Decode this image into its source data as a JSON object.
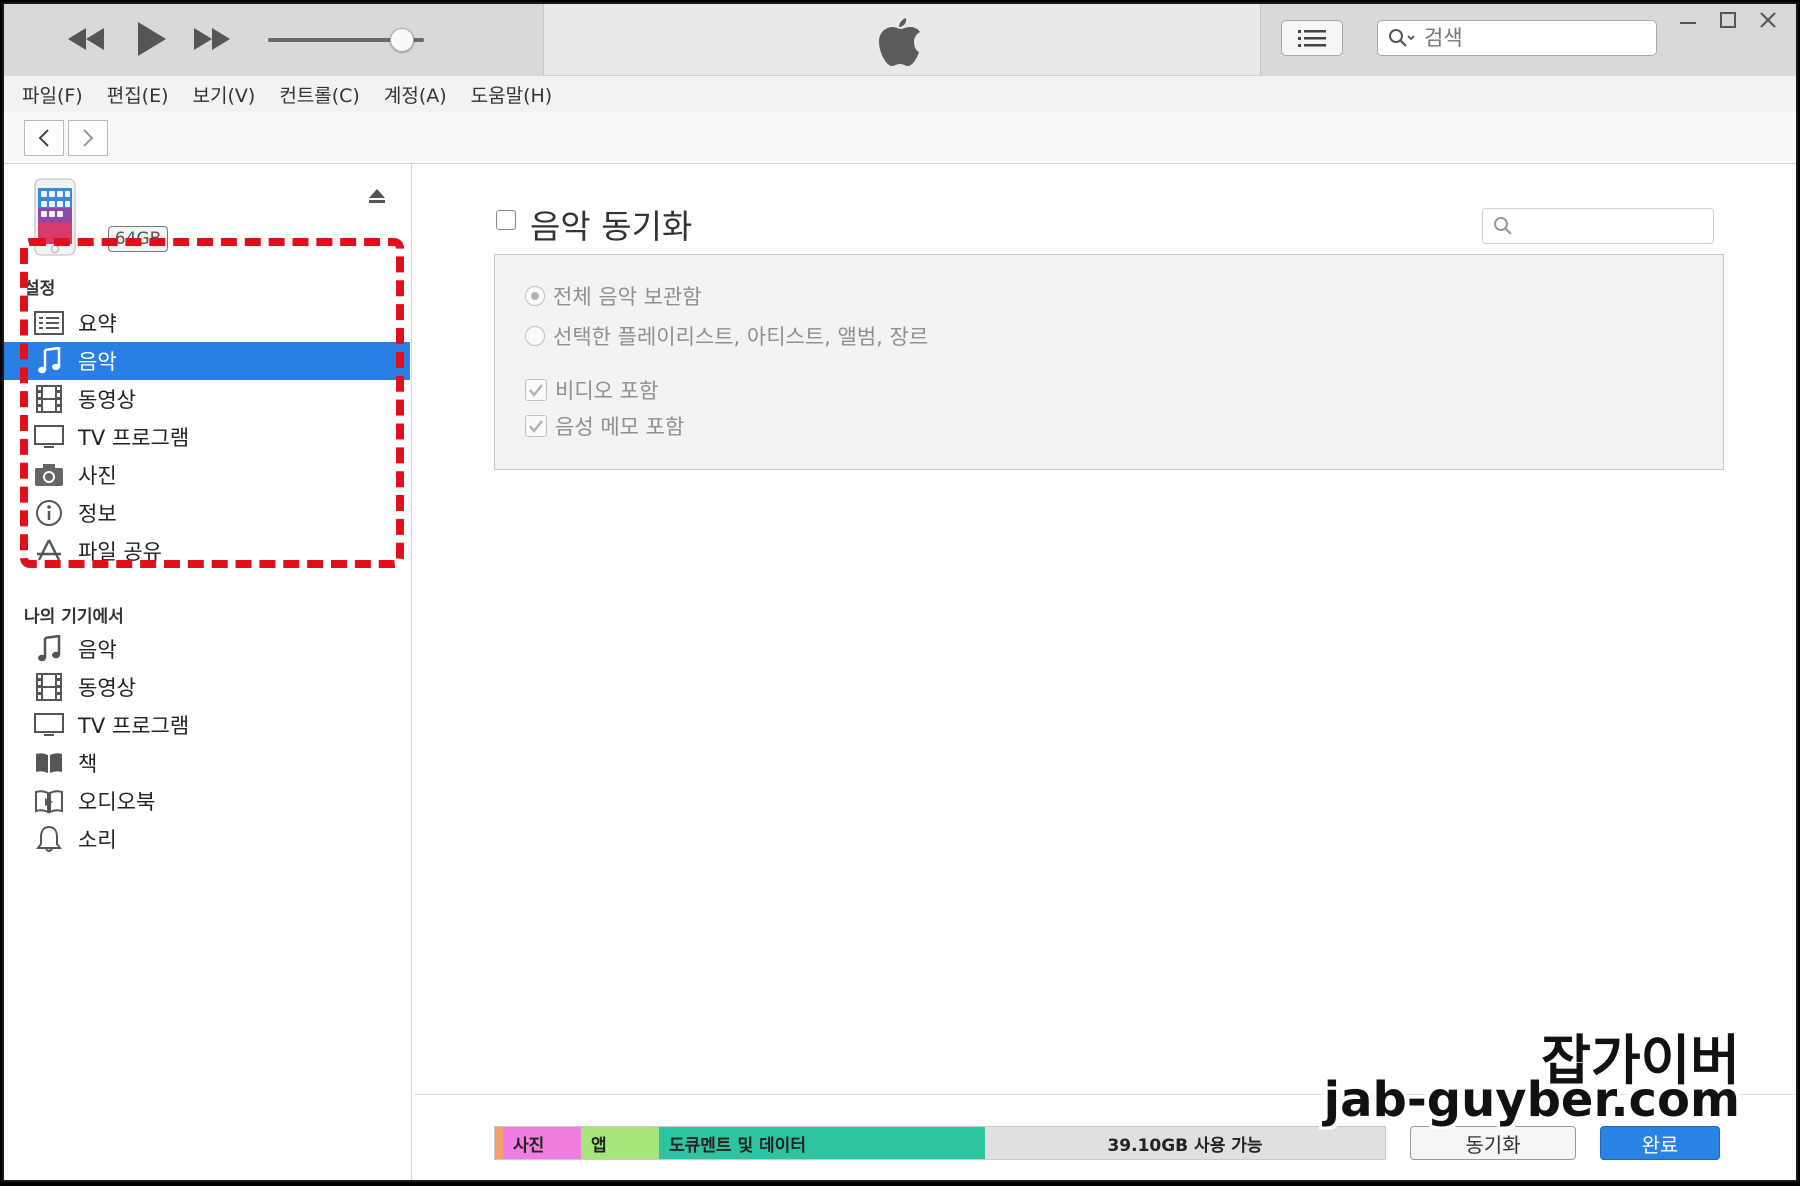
{
  "menu": [
    "파일(F)",
    "편집(E)",
    "보기(V)",
    "컨트롤(C)",
    "계정(A)",
    "도움말(H)"
  ],
  "search": {
    "placeholder": "검색"
  },
  "player": {
    "volume": 0.86
  },
  "device": {
    "capacity": "64GB"
  },
  "sidebar": {
    "settings_title": "설정",
    "settings_items": [
      {
        "label": "요약",
        "icon": "summary-icon"
      },
      {
        "label": "음악",
        "icon": "music-note-icon"
      },
      {
        "label": "동영상",
        "icon": "film-icon"
      },
      {
        "label": "TV 프로그램",
        "icon": "tv-icon"
      },
      {
        "label": "사진",
        "icon": "camera-icon"
      },
      {
        "label": "정보",
        "icon": "info-icon"
      },
      {
        "label": "파일 공유",
        "icon": "app-store-icon"
      }
    ],
    "device_title": "나의 기기에서",
    "device_items": [
      {
        "label": "음악",
        "icon": "music-note-icon"
      },
      {
        "label": "동영상",
        "icon": "film-icon"
      },
      {
        "label": "TV 프로그램",
        "icon": "tv-icon"
      },
      {
        "label": "책",
        "icon": "book-icon"
      },
      {
        "label": "오디오북",
        "icon": "audiobook-icon"
      },
      {
        "label": "소리",
        "icon": "bell-icon"
      }
    ]
  },
  "main": {
    "sync_title": "음악 동기화",
    "options": {
      "radio_all": "전체 음악 보관함",
      "radio_selected": "선택한 플레이리스트, 아티스트, 앨범, 장르",
      "include_video": "비디오 포함",
      "include_voice_memo": "음성 메모 포함"
    }
  },
  "storage": {
    "photos": "사진",
    "apps": "앱",
    "documents": "도큐멘트 및 데이터",
    "free": "39.10GB 사용 가능"
  },
  "buttons": {
    "sync": "동기화",
    "done": "완료"
  },
  "watermark": {
    "name": "잡가이버",
    "url": "jab-guyber.com"
  },
  "colors": {
    "accent": "#2a7fe4",
    "photos": "#f07ee0",
    "apps": "#a6e67c",
    "documents": "#2ec4a0",
    "free": "#e0e0e0",
    "highlight_dash": "#e0101a"
  }
}
